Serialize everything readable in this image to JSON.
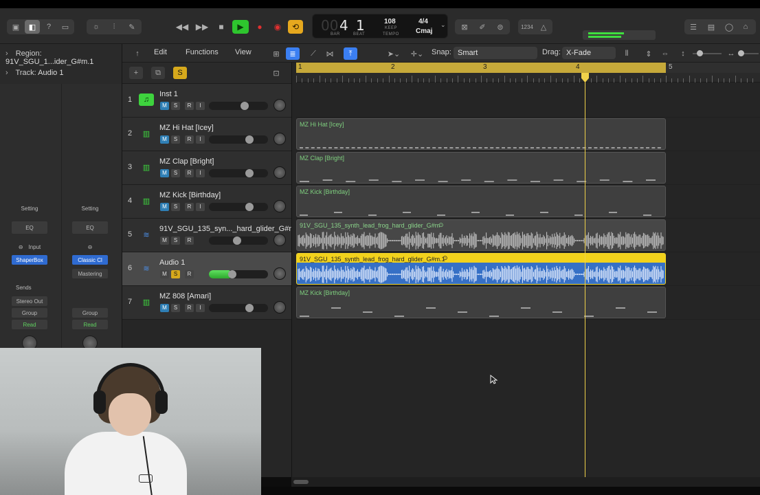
{
  "control_bar": {
    "lcd": {
      "bar": "4",
      "beat": "1",
      "bar_label": "BAR",
      "beat_label": "BEAT",
      "tempo": "108",
      "tempo_mode": "KEEP",
      "tempo_label": "TEMPO",
      "signature": "4/4",
      "key": "Cmaj"
    },
    "counter_label": "1234",
    "colors": {
      "play": "#2ec52e",
      "cycle": "#e6a81e",
      "record": "#e03030"
    }
  },
  "inspector": {
    "region_label": "Region:",
    "region_name": "91V_SGU_1...ider_G#m.1",
    "track_label": "Track:",
    "track_name": "Audio 1",
    "strip_left": {
      "setting": "Setting",
      "eq": "EQ",
      "input": "Input",
      "plugin": "ShaperBox",
      "sends": "Sends",
      "output": "Stereo Out",
      "group": "Group",
      "automation": "Read"
    },
    "strip_right": {
      "setting": "Setting",
      "eq": "EQ",
      "plugin": "Classic Cl",
      "plugin2": "Mastering",
      "group": "Group",
      "automation": "Read"
    }
  },
  "toolbar": {
    "edit": "Edit",
    "functions": "Functions",
    "view": "View",
    "snap_label": "Snap:",
    "snap_value": "Smart",
    "drag_label": "Drag:",
    "drag_value": "X-Fade"
  },
  "track_tools": {
    "solo": "S"
  },
  "tracks": [
    {
      "num": "1",
      "name": "Inst 1",
      "kind": "instrument",
      "m": "M",
      "s": "S",
      "r": "R",
      "i": "I",
      "volume": 0.62,
      "muted": true,
      "soloed": false
    },
    {
      "num": "2",
      "name": "MZ Hi Hat [Icey]",
      "kind": "drum",
      "m": "M",
      "s": "S",
      "r": "R",
      "i": "I",
      "volume": 0.72,
      "muted": true,
      "soloed": false
    },
    {
      "num": "3",
      "name": "MZ Clap [Bright]",
      "kind": "drum",
      "m": "M",
      "s": "S",
      "r": "R",
      "i": "I",
      "volume": 0.72,
      "muted": true,
      "soloed": false
    },
    {
      "num": "4",
      "name": "MZ Kick [Birthday]",
      "kind": "drum",
      "m": "M",
      "s": "S",
      "r": "R",
      "i": "I",
      "volume": 0.72,
      "muted": true,
      "soloed": false
    },
    {
      "num": "5",
      "name": "91V_SGU_135_syn..._hard_glider_G#m",
      "kind": "audio",
      "m": "M",
      "s": "S",
      "r": "R",
      "i": "",
      "volume": 0.47,
      "muted": false,
      "soloed": false
    },
    {
      "num": "6",
      "name": "Audio 1",
      "kind": "audio",
      "m": "M",
      "s": "S",
      "r": "R",
      "i": "",
      "volume": 0.38,
      "muted": false,
      "soloed": true,
      "selected": true
    },
    {
      "num": "7",
      "name": "MZ 808 [Amari]",
      "kind": "drum",
      "m": "M",
      "s": "S",
      "r": "R",
      "i": "I",
      "volume": 0.72,
      "muted": true,
      "soloed": false
    }
  ],
  "ruler": {
    "bars": [
      "1",
      "2",
      "3",
      "4",
      "5"
    ],
    "playhead_bar": 4.13
  },
  "regions": [
    {
      "lane": 1,
      "name": "MZ Hi Hat [Icey]",
      "type": "midi"
    },
    {
      "lane": 2,
      "name": "MZ Clap [Bright]",
      "type": "midi"
    },
    {
      "lane": 3,
      "name": "MZ Kick [Birthday]",
      "type": "midi"
    },
    {
      "lane": 4,
      "name": "91V_SGU_135_synth_lead_frog_hard_glider_G#m",
      "type": "audio"
    },
    {
      "lane": 5,
      "name": "91V_SGU_135_synth_lead_frog_hard_glider_G#m.1",
      "type": "audio",
      "selected": true
    },
    {
      "lane": 6,
      "name": "MZ Kick [Birthday]",
      "type": "midi"
    }
  ]
}
